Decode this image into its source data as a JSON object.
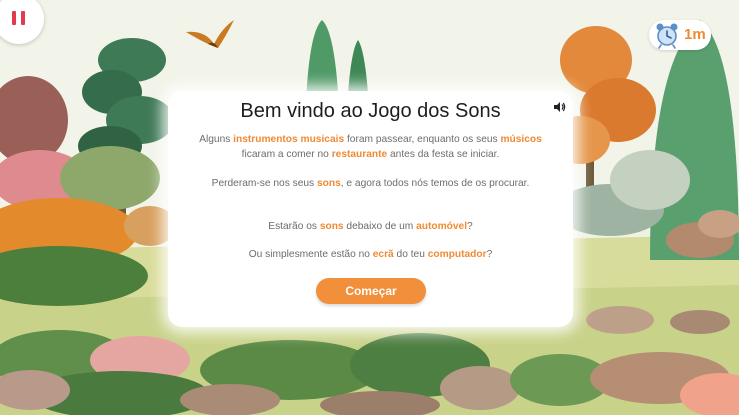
{
  "controls": {
    "pause_icon": "pause-icon",
    "timer_value": "1m",
    "timer_icon": "alarm-clock-icon",
    "sound_icon": "speaker-icon"
  },
  "dialog": {
    "title": "Bem vindo ao Jogo dos Sons",
    "p1": {
      "a": "Alguns ",
      "b": "instrumentos musicais",
      "c": " foram passear, enquanto os seus ",
      "d": "músicos",
      "e": " ficaram a comer no ",
      "f": "restaurante",
      "g": " antes da festa se iniciar."
    },
    "p2": {
      "a": "Perderam-se nos seus ",
      "b": "sons",
      "c": ", e agora todos nós temos de os procurar."
    },
    "p3": {
      "a": "Estarão os ",
      "b": "sons",
      "c": " debaixo de um ",
      "d": "automóvel",
      "e": "?"
    },
    "p4": {
      "a": "Ou simplesmente estão no ",
      "b": "ecrã",
      "c": " do teu ",
      "d": "computador",
      "e": "?"
    },
    "start_label": "Começar"
  },
  "colors": {
    "accent": "#f08a33",
    "button": "#f28f3b",
    "pause": "#e03b4e",
    "title": "#1e1e1e",
    "body_text": "#6c6c6c"
  }
}
